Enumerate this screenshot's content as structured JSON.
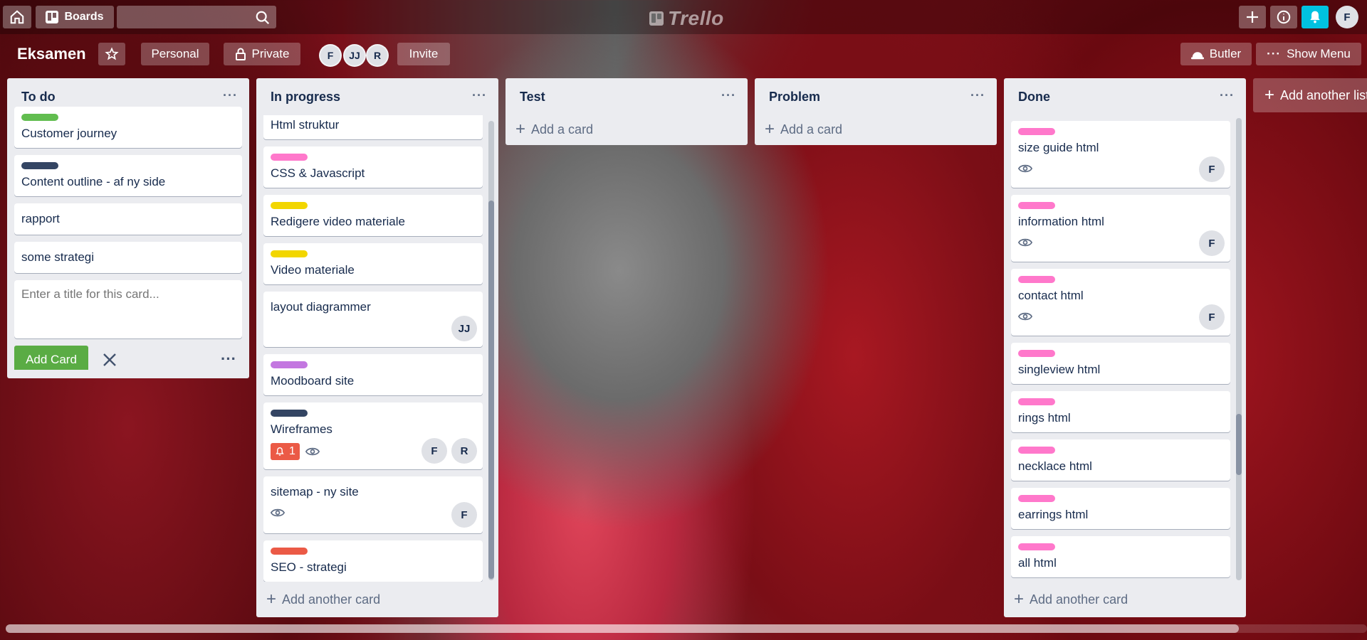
{
  "header": {
    "boards_label": "Boards",
    "logo_text": "Trello",
    "user_initial": "F"
  },
  "board": {
    "title": "Eksamen",
    "visibility_team": "Personal",
    "visibility": "Private",
    "members": [
      "F",
      "JJ",
      "R"
    ],
    "invite_label": "Invite",
    "butler_label": "Butler",
    "menu_label": "Show Menu"
  },
  "lists": {
    "todo": {
      "title": "To do",
      "cards": [
        {
          "title": "Customer journey",
          "label_color": "#61bd4f"
        },
        {
          "title": "Content outline - af ny side",
          "label_color": "#344563"
        },
        {
          "title": "rapport"
        },
        {
          "title": "some strategi"
        }
      ],
      "composer_placeholder": "Enter a title for this card...",
      "add_card_button": "Add Card"
    },
    "inprogress": {
      "title": "In progress",
      "cards": [
        {
          "title": "Html struktur",
          "label_color": "#ff78cb"
        },
        {
          "title": "CSS & Javascript",
          "label_color": "#ff78cb"
        },
        {
          "title": "Redigere video materiale",
          "label_color": "#f2d600"
        },
        {
          "title": "Video materiale",
          "label_color": "#f2d600"
        },
        {
          "title": "layout diagrammer",
          "members": [
            "JJ"
          ]
        },
        {
          "title": "Moodboard site",
          "label_color": "#c377e0"
        },
        {
          "title": "Wireframes",
          "label_color": "#344563",
          "notifications": "1",
          "members": [
            "F",
            "R"
          ]
        },
        {
          "title": "sitemap - ny site",
          "members": [
            "F"
          ]
        },
        {
          "title": "SEO - strategi",
          "label_color": "#eb5a46"
        }
      ],
      "add_card": "Add another card"
    },
    "test": {
      "title": "Test",
      "add_card": "Add a card"
    },
    "problem": {
      "title": "Problem",
      "add_card": "Add a card"
    },
    "done": {
      "title": "Done",
      "cards": [
        {
          "title": "size guide html",
          "label_color": "#ff78cb",
          "members": [
            "F"
          ]
        },
        {
          "title": "information html",
          "label_color": "#ff78cb",
          "members": [
            "F"
          ]
        },
        {
          "title": "contact html",
          "label_color": "#ff78cb",
          "members": [
            "F"
          ]
        },
        {
          "title": "singleview html",
          "label_color": "#ff78cb"
        },
        {
          "title": "rings html",
          "label_color": "#ff78cb"
        },
        {
          "title": "necklace html",
          "label_color": "#ff78cb"
        },
        {
          "title": "earrings html",
          "label_color": "#ff78cb"
        },
        {
          "title": "all html",
          "label_color": "#ff78cb"
        }
      ],
      "add_card": "Add another card"
    },
    "add_list": "Add another list"
  }
}
